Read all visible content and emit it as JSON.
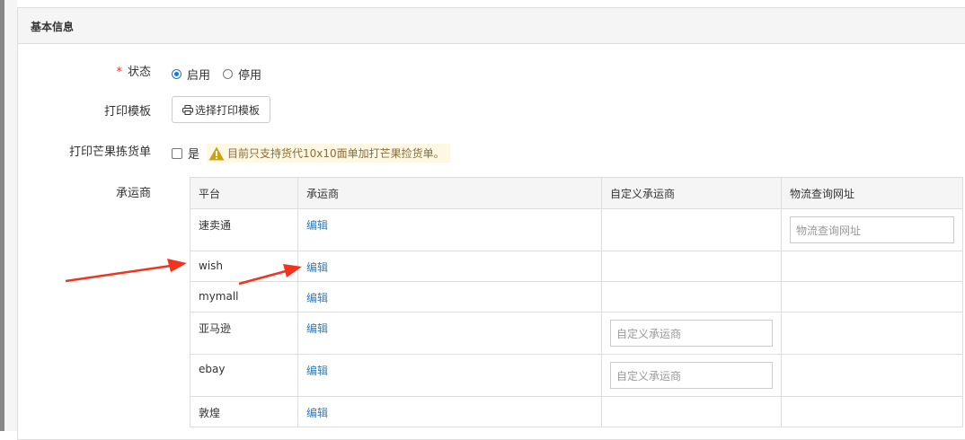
{
  "panel": {
    "title": "基本信息"
  },
  "form": {
    "status": {
      "required_mark": "*",
      "label": "状态",
      "options": [
        {
          "label": "启用",
          "checked": true
        },
        {
          "label": "停用",
          "checked": false
        }
      ]
    },
    "print_template": {
      "label": "打印模板",
      "button_label": "选择打印模板",
      "icon": "printer-icon"
    },
    "mango_pick": {
      "label": "打印芒果拣货单",
      "checkbox_label": "是",
      "checked": false,
      "warning_icon": "warning-icon",
      "warning_text": "目前只支持货代10x10面单加打芒果捡货单。"
    },
    "carrier": {
      "label": "承运商"
    }
  },
  "carrier_table": {
    "headers": [
      "平台",
      "承运商",
      "自定义承运商",
      "物流查询网址"
    ],
    "rows": [
      {
        "platform": "速卖通",
        "carrier_link": "编辑",
        "custom_placeholder": "",
        "tracking_placeholder": "物流查询网址"
      },
      {
        "platform": "wish",
        "carrier_link": "编辑",
        "custom_placeholder": "",
        "tracking_placeholder": ""
      },
      {
        "platform": "mymall",
        "carrier_link": "编辑",
        "custom_placeholder": "",
        "tracking_placeholder": ""
      },
      {
        "platform": "亚马逊",
        "carrier_link": "编辑",
        "custom_placeholder": "自定义承运商",
        "tracking_placeholder": ""
      },
      {
        "platform": "ebay",
        "carrier_link": "编辑",
        "custom_placeholder": "自定义承运商",
        "tracking_placeholder": ""
      },
      {
        "platform": "敦煌",
        "carrier_link": "编辑",
        "custom_placeholder": "",
        "tracking_placeholder": ""
      }
    ]
  },
  "colors": {
    "link": "#337ab7",
    "required": "#e4393c",
    "warning_bg": "#fcf8e3",
    "warning_icon": "#c8a415",
    "annotation_arrow": "#f5321e"
  }
}
